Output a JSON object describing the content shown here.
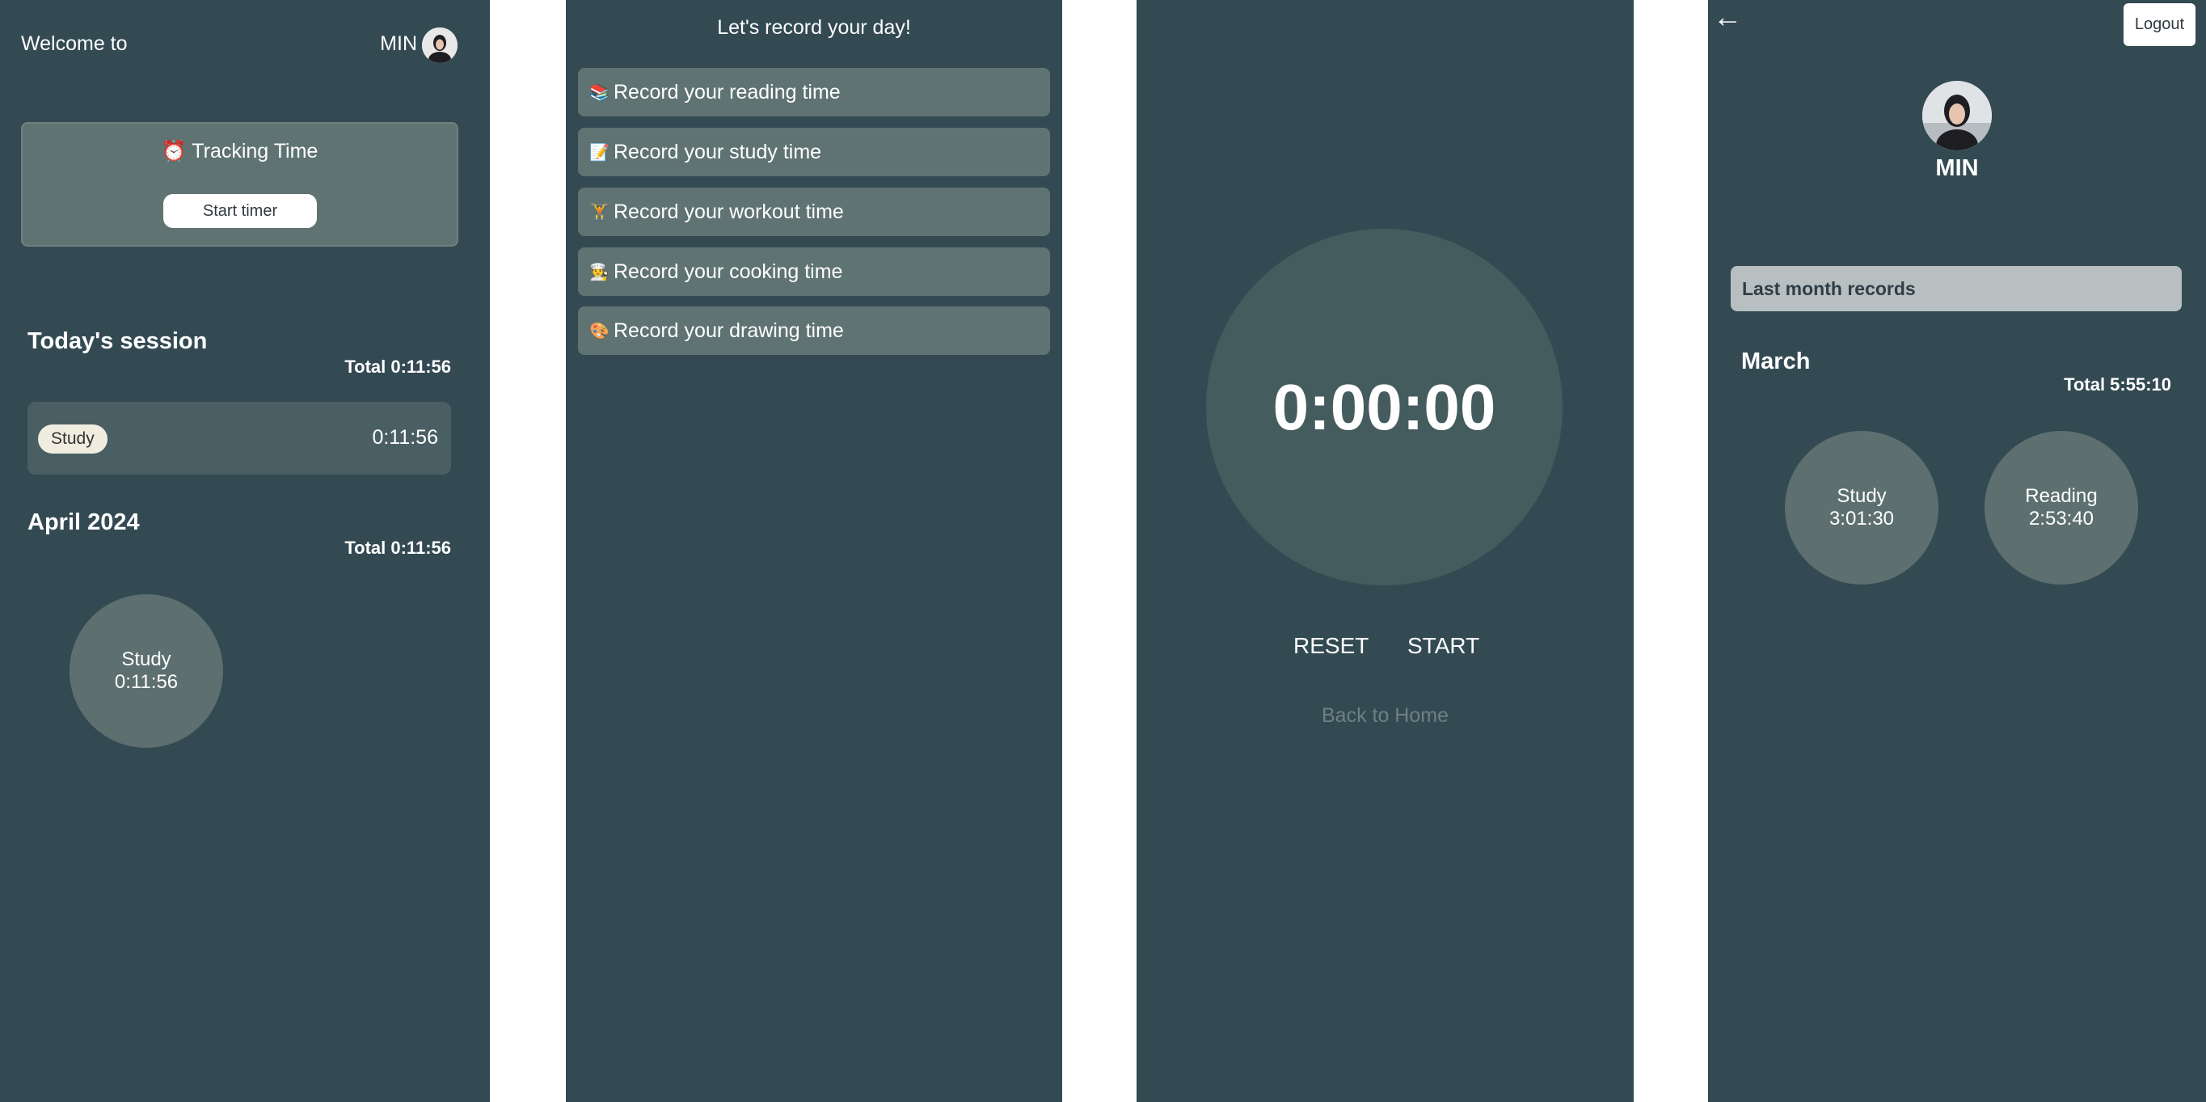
{
  "colors": {
    "panel_bg": "#334a53",
    "card_bg": "#5f7372",
    "bubble_bg": "#5d6f6f",
    "timer_circle_bg": "#455c5f",
    "pill_bg": "#f1ece0",
    "muted_text": "#6d8085"
  },
  "home": {
    "welcome": "Welcome to",
    "user_name": "MIN",
    "tracking_icon": "⏰",
    "tracking_title": "Tracking Time",
    "start_timer": "Start timer",
    "today_heading": "Today's session",
    "today_total": "Total 0:11:56",
    "session": {
      "category": "Study",
      "time": "0:11:56"
    },
    "month_heading": "April 2024",
    "month_total": "Total 0:11:56",
    "bubbles": [
      {
        "label": "Study",
        "time": "0:11:56"
      }
    ]
  },
  "record": {
    "title": "Let's record your day!",
    "items": [
      {
        "icon": "📚",
        "icon_name": "books-icon",
        "label": "Record your reading time"
      },
      {
        "icon": "📝",
        "icon_name": "memo-icon",
        "label": "Record your study time"
      },
      {
        "icon": "🏋",
        "icon_name": "weightlifter-icon",
        "label": "Record your workout time"
      },
      {
        "icon": "👨‍🍳",
        "icon_name": "chef-icon",
        "label": "Record your cooking time"
      },
      {
        "icon": "🎨",
        "icon_name": "palette-icon",
        "label": "Record your drawing time"
      }
    ]
  },
  "timer": {
    "display": "0:00:00",
    "reset": "RESET",
    "start": "START",
    "back_home": "Back to Home"
  },
  "profile": {
    "back_arrow": "←",
    "logout": "Logout",
    "name": "MIN",
    "last_month": "Last month records",
    "month": "March",
    "total": "Total 5:55:10",
    "bubbles": [
      {
        "label": "Study",
        "time": "3:01:30"
      },
      {
        "label": "Reading",
        "time": "2:53:40"
      }
    ]
  }
}
